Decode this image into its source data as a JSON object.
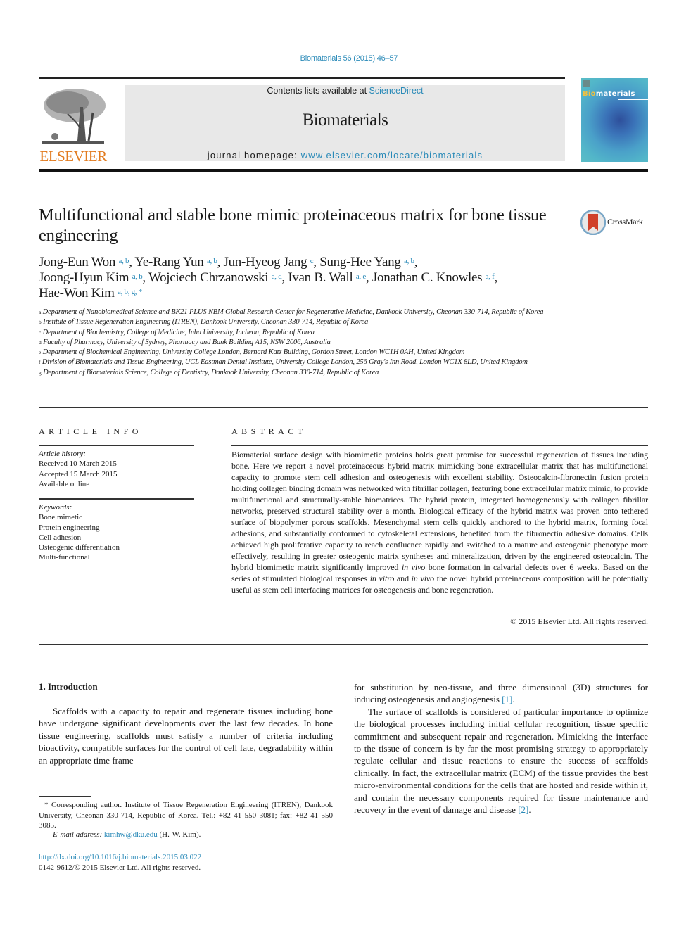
{
  "header": {
    "journal_ref": "Biomaterials 56 (2015) 46–57",
    "contents_prefix": "Contents lists available at ",
    "contents_link": "ScienceDirect",
    "journal_title": "Biomaterials",
    "homepage_prefix": "journal homepage: ",
    "homepage_link": "www.elsevier.com/locate/biomaterials",
    "publisher_logo_text": "ELSEVIER",
    "cover_title_bi": "Bio",
    "cover_title_rest": "materials"
  },
  "article": {
    "title": "Multifunctional and stable bone mimic proteinaceous matrix for bone tissue engineering",
    "crossmark_label": "CrossMark",
    "authors": [
      {
        "name": "Jong-Eun Won",
        "aff": "a, b",
        "sep": ", "
      },
      {
        "name": "Ye-Rang Yun",
        "aff": "a, b",
        "sep": ", "
      },
      {
        "name": "Jun-Hyeog Jang",
        "aff": "c",
        "sep": ", "
      },
      {
        "name": "Sung-Hee Yang",
        "aff": "a, b",
        "sep": ","
      },
      {
        "name": "Joong-Hyun Kim",
        "aff": "a, b",
        "sep": ", "
      },
      {
        "name": "Wojciech Chrzanowski",
        "aff": "a, d",
        "sep": ", "
      },
      {
        "name": "Ivan B. Wall",
        "aff": "a, e",
        "sep": ", "
      },
      {
        "name": "Jonathan C. Knowles",
        "aff": "a, f",
        "sep": ","
      },
      {
        "name": "Hae-Won Kim",
        "aff": "a, b, g, *",
        "sep": ""
      }
    ],
    "affiliations": [
      {
        "key": "a",
        "text": "Department of Nanobiomedical Science and BK21 PLUS NBM Global Research Center for Regenerative Medicine, Dankook University, Cheonan 330-714, Republic of Korea"
      },
      {
        "key": "b",
        "text": "Institute of Tissue Regeneration Engineering (ITREN), Dankook University, Cheonan 330-714, Republic of Korea"
      },
      {
        "key": "c",
        "text": "Department of Biochemistry, College of Medicine, Inha University, Incheon, Republic of Korea"
      },
      {
        "key": "d",
        "text": "Faculty of Pharmacy, University of Sydney, Pharmacy and Bank Building A15, NSW 2006, Australia"
      },
      {
        "key": "e",
        "text": "Department of Biochemical Engineering, University College London, Bernard Katz Building, Gordon Street, London WC1H 0AH, United Kingdom"
      },
      {
        "key": "f",
        "text": "Division of Biomaterials and Tissue Engineering, UCL Eastman Dental Institute, University College London, 256 Gray's Inn Road, London WC1X 8LD, United Kingdom"
      },
      {
        "key": "g",
        "text": "Department of Biomaterials Science, College of Dentistry, Dankook University, Cheonan 330-714, Republic of Korea"
      }
    ]
  },
  "article_info": {
    "heading": "ARTICLE INFO",
    "history_label": "Article history:",
    "history": [
      "Received 10 March 2015",
      "Accepted 15 March 2015",
      "Available online"
    ],
    "keywords_label": "Keywords:",
    "keywords": [
      "Bone mimetic",
      "Protein engineering",
      "Cell adhesion",
      "Osteogenic differentiation",
      "Multi-functional"
    ]
  },
  "abstract": {
    "heading": "ABSTRACT",
    "p1": "Biomaterial surface design with biomimetic proteins holds great promise for successful regeneration of tissues including bone. Here we report a novel proteinaceous hybrid matrix mimicking bone extracellular matrix that has multifunctional capacity to promote stem cell adhesion and osteogenesis with excellent stability. Osteocalcin-fibronectin fusion protein holding collagen binding domain was networked with fibrillar collagen, featuring bone extracellular matrix mimic, to provide multifunctional and structurally-stable biomatrices. The hybrid protein, integrated homogeneously with collagen fibrillar networks, preserved structural stability over a month. Biological efficacy of the hybrid matrix was proven onto tethered surface of biopolymer porous scaffolds. Mesenchymal stem cells quickly anchored to the hybrid matrix, forming focal adhesions, and substantially conformed to cytoskeletal extensions, benefited from the fibronectin adhesive domains. Cells achieved high proliferative capacity to reach confluence rapidly and switched to a mature and osteogenic phenotype more effectively, resulting in greater osteogenic matrix syntheses and mineralization, driven by the engineered osteocalcin. The hybrid biomimetic matrix significantly improved ",
    "it1": "in vivo",
    "p2": " bone formation in calvarial defects over 6 weeks. Based on the series of stimulated biological responses ",
    "it2": "in vitro",
    "p3": " and ",
    "it3": "in vivo",
    "p4": " the novel hybrid proteinaceous composition will be potentially useful as stem cell interfacing matrices for osteogenesis and bone regeneration.",
    "copyright": "© 2015 Elsevier Ltd. All rights reserved."
  },
  "body": {
    "intro_heading": "1.  Introduction",
    "left_para": "Scaffolds with a capacity to repair and regenerate tissues including bone have undergone significant developments over the last few decades. In bone tissue engineering, scaffolds must satisfy a number of criteria including bioactivity, compatible surfaces for the control of cell fate, degradability within an appropriate time frame",
    "right_para1": "for substitution by neo-tissue, and three dimensional (3D) structures for inducing osteogenesis and angiogenesis ",
    "ref1": "[1]",
    "right_para2": "The surface of scaffolds is considered of particular importance to optimize the biological processes including initial cellular recognition, tissue specific commitment and subsequent repair and regeneration. Mimicking the interface to the tissue of concern is by far the most promising strategy to appropriately regulate cellular and tissue reactions to ensure the success of scaffolds clinically. In fact, the extracellular matrix (ECM) of the tissue provides the best micro-environmental conditions for the cells that are hosted and reside within it, and contain the necessary components required for tissue maintenance and recovery in the event of damage and disease ",
    "ref2": "[2]"
  },
  "footer": {
    "corresponding": "* Corresponding author. Institute of Tissue Regeneration Engineering (ITREN), Dankook University, Cheonan 330-714, Republic of Korea. Tel.: +82 41 550 3081; fax: +82 41 550 3085.",
    "email_label": "E-mail address: ",
    "email": "kimhw@dku.edu",
    "email_suffix": " (H.-W. Kim).",
    "doi": "http://dx.doi.org/10.1016/j.biomaterials.2015.03.022",
    "issn": "0142-9612/© 2015 Elsevier Ltd. All rights reserved."
  }
}
